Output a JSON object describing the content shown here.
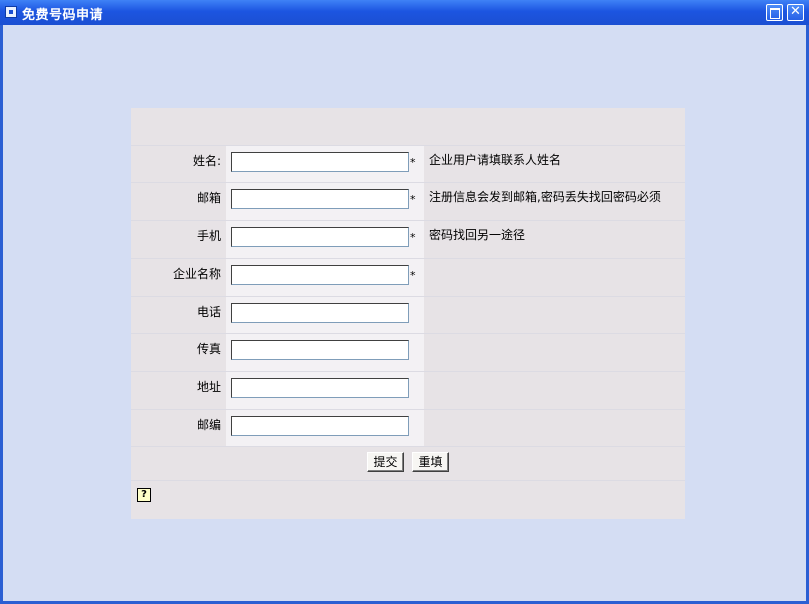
{
  "window": {
    "title": "免费号码申请",
    "maximize_icon": "maximize-icon",
    "close_label": "✕"
  },
  "form": {
    "rows": [
      {
        "label": "姓名:",
        "value": "",
        "required": "*",
        "hint": "企业用户请填联系人姓名"
      },
      {
        "label": "邮箱",
        "value": "",
        "required": "*",
        "hint": "注册信息会发到邮箱,密码丢失找回密码必须"
      },
      {
        "label": "手机",
        "value": "",
        "required": "*",
        "hint": "密码找回另一途径"
      },
      {
        "label": "企业名称",
        "value": "",
        "required": "*",
        "hint": ""
      },
      {
        "label": "电话",
        "value": "",
        "required": "",
        "hint": ""
      },
      {
        "label": "传真",
        "value": "",
        "required": "",
        "hint": ""
      },
      {
        "label": "地址",
        "value": "",
        "required": "",
        "hint": ""
      },
      {
        "label": "邮编",
        "value": "",
        "required": "",
        "hint": ""
      }
    ],
    "submit_label": "提交",
    "reset_label": "重填",
    "help_icon": "help-icon",
    "help_glyph": "?"
  },
  "colors": {
    "titlebar": "#1c55e1",
    "window_bg": "#d4ddf3",
    "panel_bg": "#e7e3e6",
    "input_cell_bg": "#f3f1f4"
  }
}
